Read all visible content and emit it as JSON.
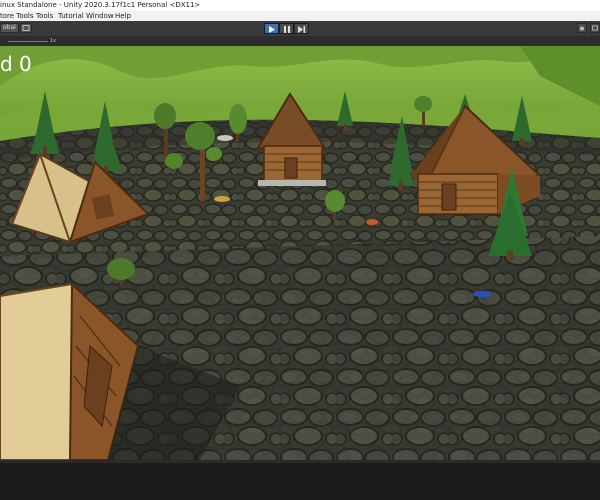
{
  "window": {
    "title": "inux Standalone - Unity 2020.3.17f1c1 Personal <DX11>"
  },
  "menu": {
    "items": [
      "tore Tools",
      "Tools",
      "Tutorial",
      "Window",
      "Help"
    ]
  },
  "toolbar": {
    "left_button_label": "obal",
    "play_controls": [
      "play",
      "pause",
      "step"
    ],
    "play_active": "play"
  },
  "gameview": {
    "scale_label": "",
    "scale_value": "1x"
  },
  "game": {
    "score_text": "d 0"
  },
  "colors": {
    "play_active": "#3d6fb4",
    "toolbar_bg": "#3a3a3a",
    "sky_green": "#74a53a",
    "ground": "#3b3d35",
    "tree_green": "#2f6b2f",
    "wood": "#8a5a2b"
  }
}
